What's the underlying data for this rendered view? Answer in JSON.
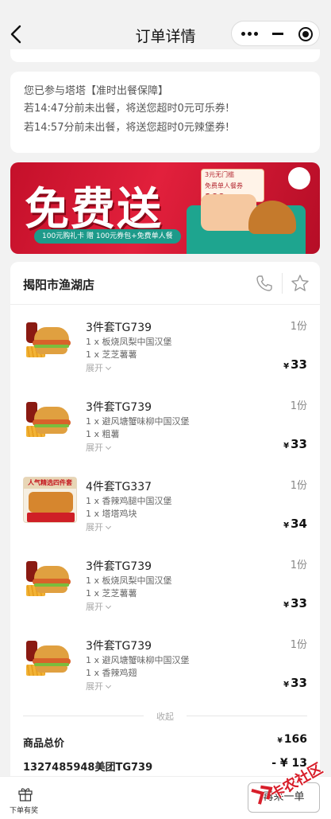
{
  "nav": {
    "title": "订单详情"
  },
  "guarantee": {
    "line1": "您已参与塔塔【准时出餐保障】",
    "line2": "若14:47分前未出餐，将送您超时0元可乐券!",
    "line3": "若14:57分前未出餐，将送您超时0元辣堡券!"
  },
  "banner": {
    "headline": "免费送",
    "pill": "100元购礼卡 赠 100元券包+免费单人餐",
    "coupon_line1": "3元无门槛",
    "coupon_line2": "免费单人餐券",
    "coupon_value": "100"
  },
  "shop": {
    "name": "揭阳市渔湖店"
  },
  "items": [
    {
      "name": "3件套TG739",
      "sub1": "1 x 板烧凤梨中国汉堡",
      "sub2": "1 x 芝芝薯薯",
      "expand": "展开",
      "qty": "1份",
      "currency": "¥",
      "price": "33"
    },
    {
      "name": "3件套TG739",
      "sub1": "1 x 避风塘蟹味柳中国汉堡",
      "sub2": "1 x 粗薯",
      "expand": "展开",
      "qty": "1份",
      "currency": "¥",
      "price": "33"
    },
    {
      "name": "4件套TG337",
      "sub1": "1 x 香辣鸡腿中国汉堡",
      "sub2": "1 x 塔塔鸡块",
      "expand": "展开",
      "qty": "1份",
      "currency": "¥",
      "price": "34",
      "thumb_tag": "人气精选四件套"
    },
    {
      "name": "3件套TG739",
      "sub1": "1 x 板烧凤梨中国汉堡",
      "sub2": "1 x 芝芝薯薯",
      "expand": "展开",
      "qty": "1份",
      "currency": "¥",
      "price": "33"
    },
    {
      "name": "3件套TG739",
      "sub1": "1 x 避风塘蟹味柳中国汉堡",
      "sub2": "1 x 香辣鸡翅",
      "expand": "展开",
      "qty": "1份",
      "currency": "¥",
      "price": "33"
    }
  ],
  "collapse_label": "收起",
  "summary": {
    "total_label": "商品总价",
    "total_currency": "¥",
    "total_value": "166",
    "discount_label": "1327485948美团TG739",
    "discount_value": "- ¥ 13"
  },
  "bottom": {
    "gift_label": "下单有奖",
    "reorder_label": "再来一单"
  },
  "watermark": {
    "text": "卡农社区"
  },
  "colors": {
    "brand_red": "#d81e2a",
    "banner_teal": "#1d9a8a"
  }
}
